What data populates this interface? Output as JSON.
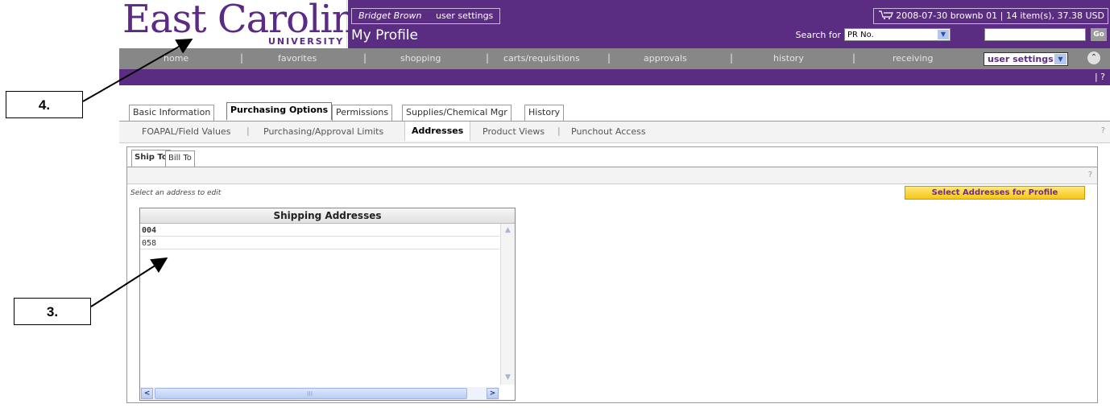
{
  "logo": {
    "name": "East Carolina",
    "sub": "UNIVERSITY"
  },
  "header": {
    "user_name": "Bridget Brown",
    "user_settings_link": "user settings",
    "page_title": "My Profile",
    "cart_icon": "cart-icon",
    "cart_summary": "2008-07-30 brownb 01 | 14 item(s), 37.38 USD",
    "search_label": "Search for",
    "search_select_value": "PR No.",
    "search_value": "",
    "go_label": "Go"
  },
  "nav": {
    "items": [
      "home",
      "favorites",
      "shopping",
      "carts/requisitions",
      "approvals",
      "history",
      "receiving"
    ],
    "selected_value": "user settings",
    "help": "| ?"
  },
  "tabs": [
    "Basic Information",
    "Purchasing Options",
    "Permissions",
    "Supplies/Chemical Mgr",
    "History"
  ],
  "active_tab": "Purchasing Options",
  "subnav": {
    "items": [
      "FOAPAL/Field Values",
      "Purchasing/Approval Limits",
      "Addresses",
      "Product Views",
      "Punchout Access"
    ],
    "active": "Addresses",
    "help": "?"
  },
  "subtabs": [
    "Ship To",
    "Bill To"
  ],
  "content": {
    "help": "?",
    "hint": "Select an address to edit",
    "select_button": "Select Addresses for Profile",
    "table": {
      "header": "Shipping Addresses",
      "rows": [
        "004",
        "058"
      ]
    }
  },
  "annotations": [
    "3.",
    "4."
  ]
}
